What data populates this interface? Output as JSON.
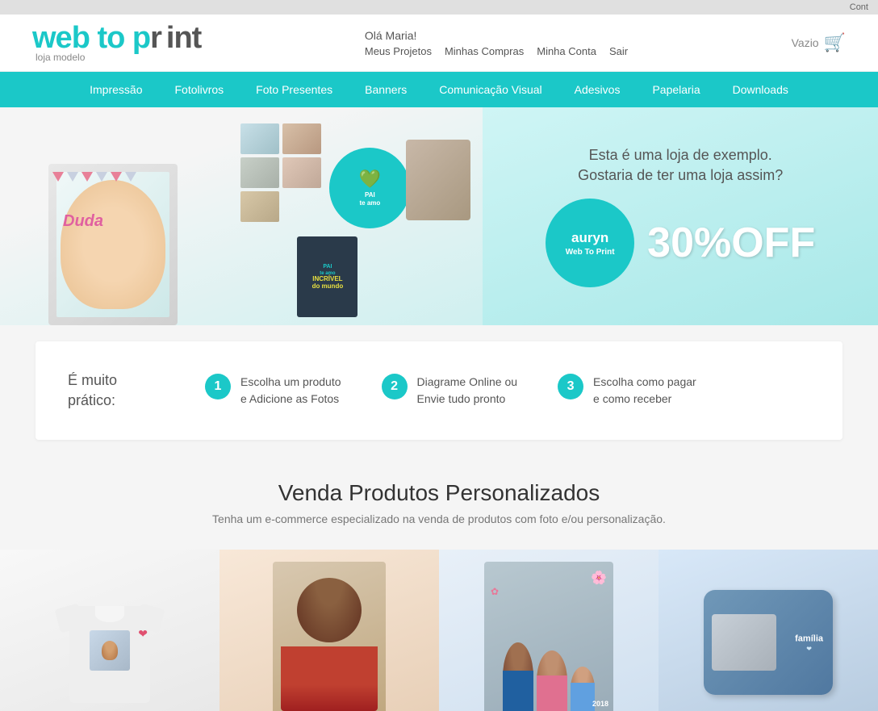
{
  "topbar": {
    "label": "Cont"
  },
  "header": {
    "logo_main": "web to print",
    "logo_subtitle": "loja modelo",
    "greeting": "Olá Maria!",
    "links": {
      "meus_projetos": "Meus Projetos",
      "minhas_compras": "Minhas Compras",
      "minha_conta": "Minha Conta",
      "sair": "Sair"
    },
    "cart_label": "Vazio"
  },
  "nav": {
    "items": [
      {
        "label": "Impressão",
        "id": "impressao"
      },
      {
        "label": "Fotolivros",
        "id": "fotolivros"
      },
      {
        "label": "Foto Presentes",
        "id": "foto-presentes"
      },
      {
        "label": "Banners",
        "id": "banners"
      },
      {
        "label": "Comunicação Visual",
        "id": "comunicacao-visual"
      },
      {
        "label": "Adesivos",
        "id": "adesivos"
      },
      {
        "label": "Papelaria",
        "id": "papelaria"
      },
      {
        "label": "Downloads",
        "id": "downloads"
      }
    ]
  },
  "banner": {
    "tagline_line1": "Esta é uma loja de exemplo.",
    "tagline_line2": "Gostaria de ter uma loja assim?",
    "promo_brand": "auryn",
    "promo_sub": "Web To Print",
    "promo_percent": "30%OFF",
    "notebook_text": "PAI\nIncrível\ndo mundo",
    "duda_label": "Duda"
  },
  "steps": {
    "label": "É muito\nprático:",
    "items": [
      {
        "number": "1",
        "text_line1": "Escolha um produto",
        "text_line2": "e Adicione as Fotos"
      },
      {
        "number": "2",
        "text_line1": "Diagrame Online ou",
        "text_line2": "Envie tudo pronto"
      },
      {
        "number": "3",
        "text_line1": "Escolha como pagar",
        "text_line2": "e como receber"
      }
    ]
  },
  "venda": {
    "title": "Venda Produtos Personalizados",
    "subtitle": "Tenha um e-commerce especializado na venda de produtos com foto e/ou personalização."
  },
  "products": {
    "items": [
      {
        "id": "tshirt",
        "type": "tshirt"
      },
      {
        "id": "person",
        "type": "person"
      },
      {
        "id": "couple",
        "type": "couple"
      },
      {
        "id": "pillow",
        "type": "pillow"
      }
    ]
  }
}
